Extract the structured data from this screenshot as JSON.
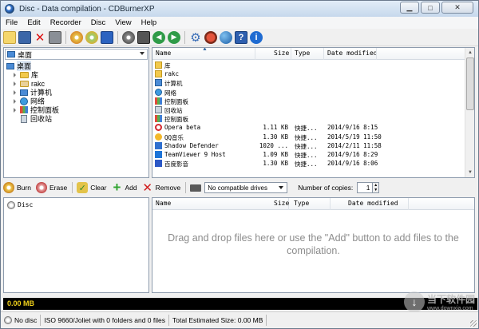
{
  "window": {
    "title": "Disc - Data compilation - CDBurnerXP"
  },
  "menu": [
    "File",
    "Edit",
    "Recorder",
    "Disc",
    "View",
    "Help"
  ],
  "tree": {
    "location": "桌面",
    "items": [
      {
        "label": "桌面",
        "icon": "desktop-icon"
      },
      {
        "label": "库",
        "icon": "folder-icon"
      },
      {
        "label": "rakc",
        "icon": "user-folder-icon"
      },
      {
        "label": "计算机",
        "icon": "computer-icon"
      },
      {
        "label": "网络",
        "icon": "network-icon"
      },
      {
        "label": "控制面板",
        "icon": "control-panel-icon"
      },
      {
        "label": "回收站",
        "icon": "recycle-bin-icon"
      }
    ]
  },
  "file_list": {
    "columns": [
      "Name",
      "Size",
      "Type",
      "Date modified"
    ],
    "rows": [
      {
        "name": "库",
        "size": "",
        "type": "",
        "date": "",
        "icon": "folder-icon"
      },
      {
        "name": "rakc",
        "size": "",
        "type": "",
        "date": "",
        "icon": "folder-icon"
      },
      {
        "name": "计算机",
        "size": "",
        "type": "",
        "date": "",
        "icon": "computer-icon"
      },
      {
        "name": "网络",
        "size": "",
        "type": "",
        "date": "",
        "icon": "network-icon"
      },
      {
        "name": "控制面板",
        "size": "",
        "type": "",
        "date": "",
        "icon": "control-panel-icon"
      },
      {
        "name": "回收站",
        "size": "",
        "type": "",
        "date": "",
        "icon": "recycle-bin-icon"
      },
      {
        "name": "控制面板",
        "size": "",
        "type": "",
        "date": "",
        "icon": "control-panel-icon"
      },
      {
        "name": "Opera beta",
        "size": "1.11 KB",
        "type": "快捷...",
        "date": "2014/9/16 8:15",
        "icon": "opera-icon"
      },
      {
        "name": "QQ音乐",
        "size": "1.30 KB",
        "type": "快捷...",
        "date": "2014/5/19 11:50",
        "icon": "qq-music-icon"
      },
      {
        "name": "Shadow Defender",
        "size": "1020 ...",
        "type": "快捷...",
        "date": "2014/2/11 11:58",
        "icon": "shadow-defender-icon"
      },
      {
        "name": "TeamViewer 9 Host",
        "size": "1.09 KB",
        "type": "快捷...",
        "date": "2014/9/16 8:29",
        "icon": "teamviewer-icon"
      },
      {
        "name": "百度影音",
        "size": "1.30 KB",
        "type": "快捷...",
        "date": "2014/9/16 8:06",
        "icon": "baidu-player-icon"
      }
    ]
  },
  "actions": {
    "burn": "Burn",
    "erase": "Erase",
    "clear": "Clear",
    "add": "Add",
    "remove": "Remove",
    "drive": "No compatible drives",
    "copies_label": "Number of copies:",
    "copies_value": "1"
  },
  "compilation": {
    "root": "Disc",
    "columns": [
      "Name",
      "Size",
      "Type",
      "Date modified"
    ],
    "drop_message": "Drag and drop files here or use the \"Add\" button to add files to the compilation."
  },
  "capacity": {
    "used": "0.00 MB"
  },
  "watermark": {
    "main": "当下软件园",
    "sub": "www.downxia.com"
  },
  "status": {
    "disc": "No disc",
    "filesystem": "ISO 9660/Joliet with 0 folders and 0 files",
    "estimated": "Total Estimated Size: 0.00 MB"
  },
  "colors": {
    "capacity_text": "#f2d21b",
    "titlebar": "#c6d8ec"
  }
}
